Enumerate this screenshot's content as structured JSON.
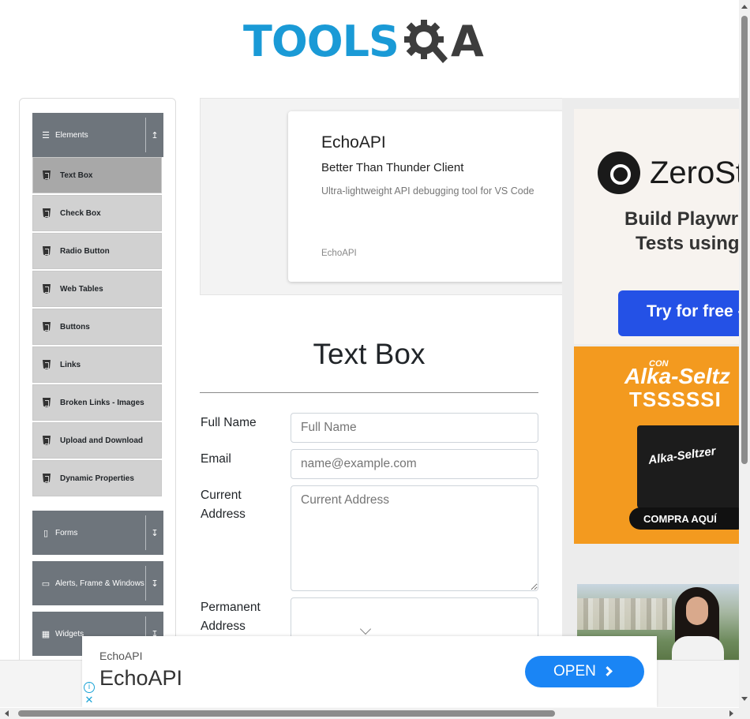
{
  "header": {
    "logo_tools": "TOOLS",
    "logo_qa": "A",
    "brand_color": "#1a9ad6"
  },
  "sidebar": {
    "groups": [
      {
        "label": "Elements",
        "icon": "hamburger-icon",
        "arrow": "↥",
        "expanded": true
      },
      {
        "label": "Forms",
        "icon": "file-icon",
        "arrow": "↧",
        "expanded": false
      },
      {
        "label": "Alerts, Frame & Windows",
        "icon": "window-icon",
        "arrow": "↧",
        "expanded": false
      },
      {
        "label": "Widgets",
        "icon": "grid-icon",
        "arrow": "↧",
        "expanded": false
      }
    ],
    "items": [
      {
        "label": "Text Box",
        "active": true
      },
      {
        "label": "Check Box",
        "active": false
      },
      {
        "label": "Radio Button",
        "active": false
      },
      {
        "label": "Web Tables",
        "active": false
      },
      {
        "label": "Buttons",
        "active": false
      },
      {
        "label": "Links",
        "active": false
      },
      {
        "label": "Broken Links - Images",
        "active": false
      },
      {
        "label": "Upload and Download",
        "active": false
      },
      {
        "label": "Dynamic Properties",
        "active": false
      }
    ]
  },
  "ad_card": {
    "title": "EchoAPI",
    "subtitle": "Better Than Thunder Client",
    "description": "Ultra-lightweight API debugging tool for VS Code",
    "footer": "EchoAPI"
  },
  "main": {
    "page_title": "Text Box",
    "form": {
      "full_name_label": "Full Name",
      "full_name_placeholder": "Full Name",
      "email_label": "Email",
      "email_placeholder": "name@example.com",
      "current_address_label_1": "Current",
      "current_address_label_2": "Address",
      "current_address_placeholder": "Current Address",
      "permanent_address_label_1": "Permanent",
      "permanent_address_label_2": "Address"
    }
  },
  "right_ads": {
    "zerostep": {
      "name": "ZeroSt",
      "line1": "Build Playwri",
      "line2": "Tests using",
      "button": "Try for free -"
    },
    "alka": {
      "top": "CON",
      "brand": "Alka-Seltz",
      "sound": "TSSSSSI",
      "box_name": "Alka-Seltzer",
      "button": "COMPRA AQUÍ"
    }
  },
  "bottom_banner": {
    "small": "EchoAPI",
    "big": "EchoAPI",
    "button": "OPEN",
    "info": "i",
    "close": "✕",
    "button_color": "#1a85f5"
  }
}
